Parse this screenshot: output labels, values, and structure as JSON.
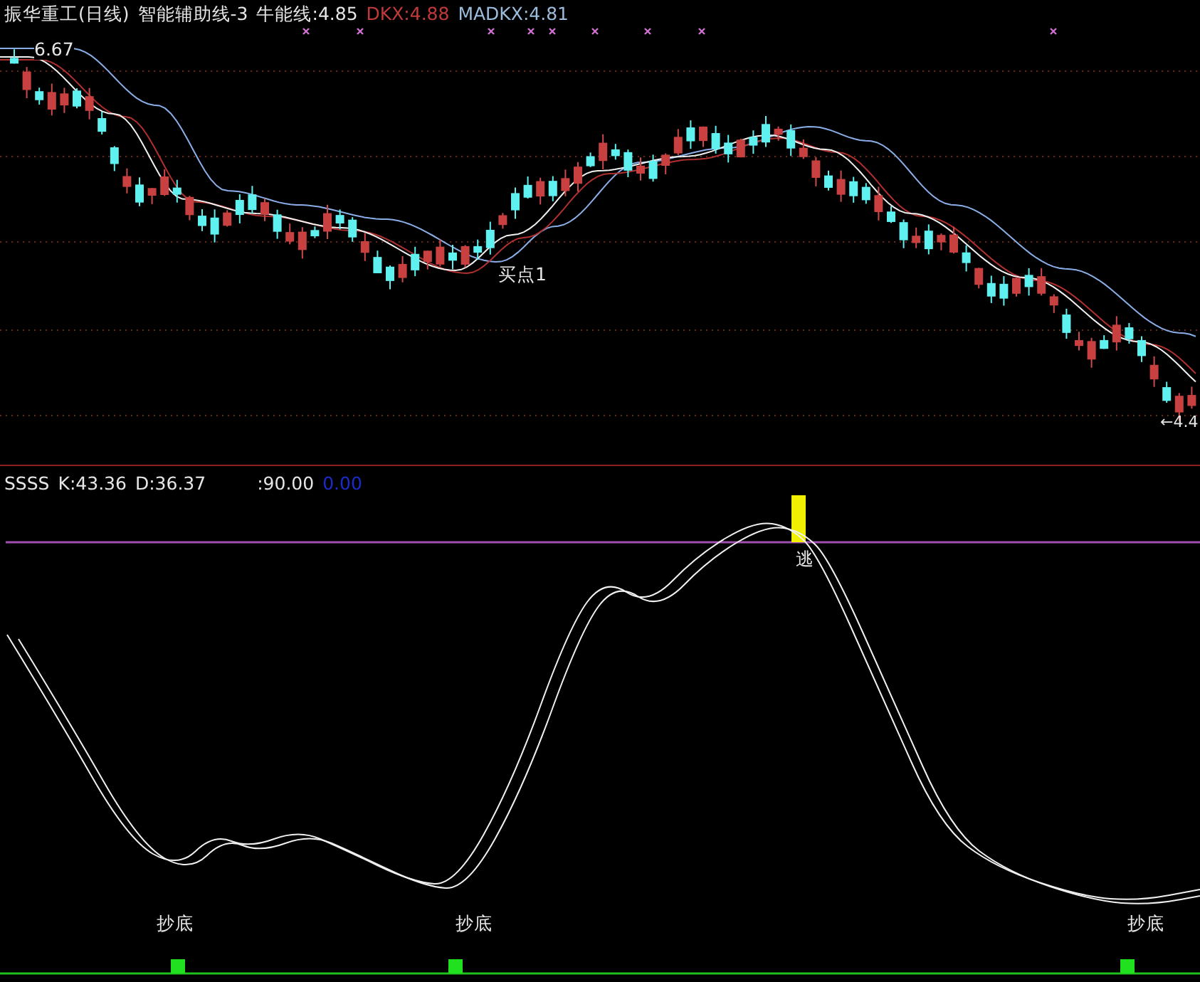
{
  "price_panel": {
    "title": "振华重工(日线)",
    "indicator": "智能辅助线-3",
    "readouts": [
      {
        "text": "牛能线:4.85",
        "color": "#e6e6e6"
      },
      {
        "text": "DKX:4.88",
        "color": "#c03a3a"
      },
      {
        "text": "MADKX:4.81",
        "color": "#9cbcdc"
      }
    ],
    "high_label": "6.67",
    "low_label": "←4.4",
    "signal_label": "买点1"
  },
  "oscillator_panel": {
    "name": "SSSS",
    "readouts": [
      {
        "text": "K:43.36",
        "color": "#e6e6e6"
      },
      {
        "text": "D:36.37",
        "color": "#e6e6e6"
      },
      {
        "text": ":90.00",
        "color": "#e6e6e6"
      },
      {
        "text": "0.00",
        "color": "#1c2ccc"
      }
    ],
    "escape_label": "逃",
    "bottom_labels": [
      "抄底",
      "抄底",
      "抄底"
    ]
  }
}
